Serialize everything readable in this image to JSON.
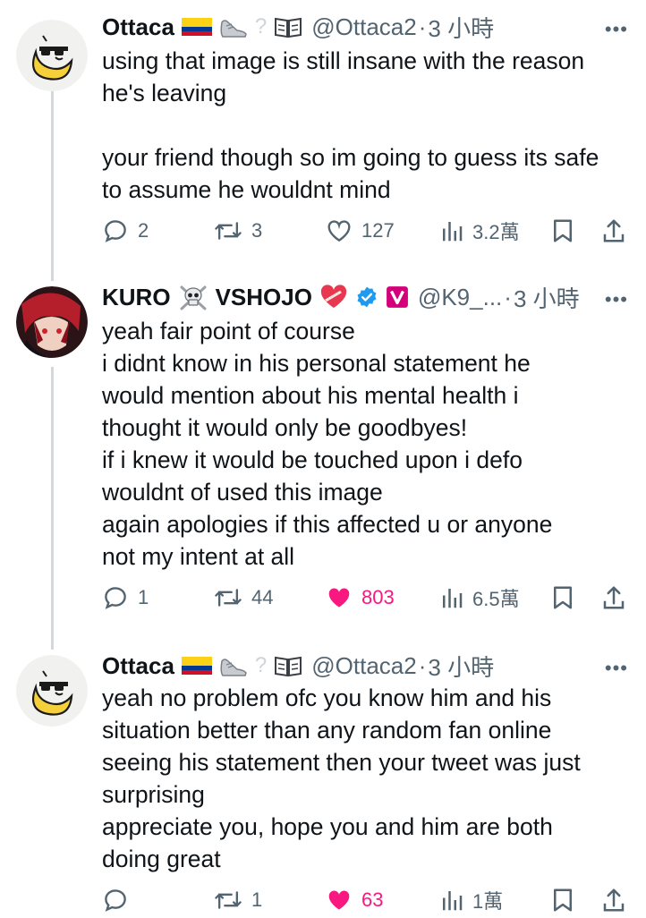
{
  "tweets": [
    {
      "name": "Ottaca",
      "handle": "@Ottaca2",
      "time": "3 小時",
      "body": [
        "using that image is still insane with the reason",
        "he's leaving",
        "",
        "your friend though so im going to guess its safe",
        "to assume he wouldnt mind"
      ],
      "stats": {
        "replies": "2",
        "retweets": "3",
        "likes": "127",
        "views": "3.2萬"
      },
      "liked": false
    },
    {
      "name": "KURO",
      "name_suffix": "VSHOJO",
      "handle": "@K9_...",
      "time": "3 小時",
      "body": [
        "yeah fair point of course",
        "i didnt know in his personal statement he",
        "would mention about his mental health i",
        "thought it would only be goodbyes!",
        "if i knew it would be touched upon i defo",
        "wouldnt of used this image",
        "again apologies if this affected u or anyone",
        "not my intent at all"
      ],
      "stats": {
        "replies": "1",
        "retweets": "44",
        "likes": "803",
        "views": "6.5萬"
      },
      "liked": true
    },
    {
      "name": "Ottaca",
      "handle": "@Ottaca2",
      "time": "3 小時",
      "body": [
        "yeah no problem ofc you know him and his",
        "situation better than any random fan online",
        "seeing his statement then your tweet was just",
        "surprising",
        "appreciate you, hope you and him are both",
        "doing great"
      ],
      "stats": {
        "replies": "",
        "retweets": "1",
        "likes": "63",
        "views": "1萬"
      },
      "liked": true
    }
  ],
  "colors": {
    "text": "#0f1419",
    "muted": "#536471",
    "like": "#f91880",
    "verified": "#1d9bf0",
    "vshojo": "#d4007a",
    "thread_line": "#cfd9de"
  },
  "icons": [
    "reply-icon",
    "retweet-icon",
    "like-icon",
    "views-icon",
    "bookmark-icon",
    "share-icon",
    "more-icon"
  ]
}
